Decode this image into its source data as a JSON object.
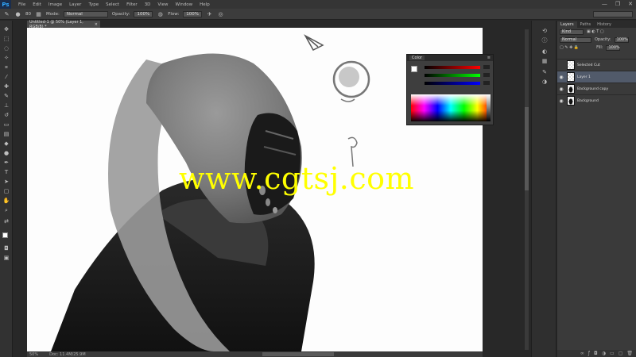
{
  "app": {
    "logo": "Ps"
  },
  "menu": [
    "File",
    "Edit",
    "Image",
    "Layer",
    "Type",
    "Select",
    "Filter",
    "3D",
    "View",
    "Window",
    "Help"
  ],
  "window_controls": [
    "—",
    "❐",
    "✕"
  ],
  "options_bar": {
    "brush_size": "80",
    "mode_label": "Mode:",
    "mode_value": "Normal",
    "opacity_label": "Opacity:",
    "opacity_value": "100%",
    "flow_label": "Flow:",
    "flow_value": "100%"
  },
  "document": {
    "tab_title": "Untitled-1 @ 50% (Layer 1, RGB/8) *",
    "zoom": "50%",
    "status": "Doc: 11.4M/25.9M",
    "watermark": "www.cgtsj.com"
  },
  "color_panel": {
    "tab": "Color",
    "r": "0",
    "g": "0",
    "b": "0"
  },
  "layers_panel": {
    "tabs": [
      "Layers",
      "Paths",
      "History"
    ],
    "kind_label": "Kind",
    "blend_mode": "Normal",
    "opacity_label": "Opacity:",
    "opacity_value": "100%",
    "fill_label": "Fill:",
    "fill_value": "100%",
    "layers": [
      {
        "name": "Selected Cut",
        "visible": false,
        "thumb": "checker",
        "selected": false
      },
      {
        "name": "Layer 1",
        "visible": true,
        "thumb": "checker",
        "selected": true
      },
      {
        "name": "Background copy",
        "visible": true,
        "thumb": "dark",
        "selected": false
      },
      {
        "name": "Background",
        "visible": true,
        "thumb": "dark",
        "selected": false
      }
    ]
  },
  "colors": {
    "ps_blue": "#31a8ff",
    "selected_layer": "#515a6a",
    "watermark": "#ffff00"
  }
}
